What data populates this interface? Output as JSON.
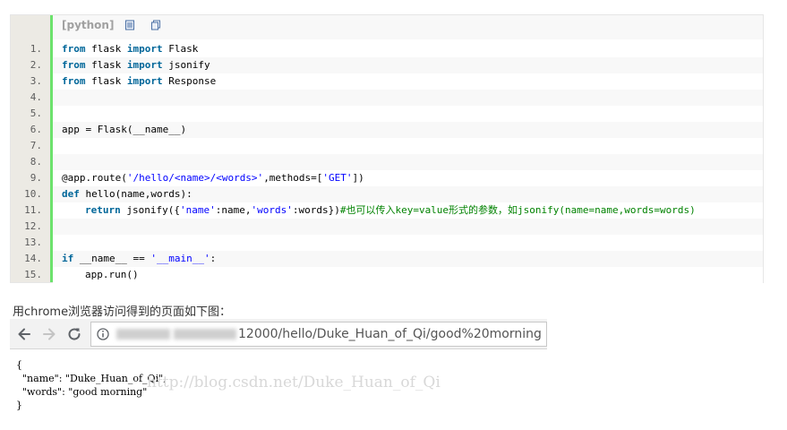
{
  "code_block": {
    "language_label": "[python]",
    "toolbar_icons": [
      "view-source-icon",
      "copy-icon"
    ],
    "lines": [
      {
        "num": "1.",
        "tokens": [
          {
            "t": "from",
            "c": "kw"
          },
          {
            "t": " flask ",
            "c": ""
          },
          {
            "t": "import",
            "c": "kw"
          },
          {
            "t": " Flask",
            "c": ""
          }
        ]
      },
      {
        "num": "2.",
        "tokens": [
          {
            "t": "from",
            "c": "kw"
          },
          {
            "t": " flask ",
            "c": ""
          },
          {
            "t": "import",
            "c": "kw"
          },
          {
            "t": " jsonify",
            "c": ""
          }
        ]
      },
      {
        "num": "3.",
        "tokens": [
          {
            "t": "from",
            "c": "kw"
          },
          {
            "t": " flask ",
            "c": ""
          },
          {
            "t": "import",
            "c": "kw"
          },
          {
            "t": " Response",
            "c": ""
          }
        ]
      },
      {
        "num": "4.",
        "tokens": []
      },
      {
        "num": "5.",
        "tokens": []
      },
      {
        "num": "6.",
        "tokens": [
          {
            "t": "app = Flask(__name__)",
            "c": ""
          }
        ]
      },
      {
        "num": "7.",
        "tokens": []
      },
      {
        "num": "8.",
        "tokens": []
      },
      {
        "num": "9.",
        "tokens": [
          {
            "t": "@app.route(",
            "c": ""
          },
          {
            "t": "'/hello/<name>/<words>'",
            "c": "str"
          },
          {
            "t": ",methods=[",
            "c": ""
          },
          {
            "t": "'GET'",
            "c": "str"
          },
          {
            "t": "])",
            "c": ""
          }
        ]
      },
      {
        "num": "10.",
        "tokens": [
          {
            "t": "def",
            "c": "kw"
          },
          {
            "t": " hello(name,words):",
            "c": ""
          }
        ]
      },
      {
        "num": "11.",
        "indent": true,
        "tokens": [
          {
            "t": "return",
            "c": "kw"
          },
          {
            "t": " jsonify({",
            "c": ""
          },
          {
            "t": "'name'",
            "c": "str"
          },
          {
            "t": ":name,",
            "c": ""
          },
          {
            "t": "'words'",
            "c": "str"
          },
          {
            "t": ":words})",
            "c": ""
          },
          {
            "t": "#也可以传入key=value形式的参数，如jsonify(name=name,words=words)",
            "c": "cmt"
          }
        ]
      },
      {
        "num": "12.",
        "tokens": []
      },
      {
        "num": "13.",
        "tokens": []
      },
      {
        "num": "14.",
        "tokens": [
          {
            "t": "if",
            "c": "kw"
          },
          {
            "t": " __name__ == ",
            "c": ""
          },
          {
            "t": "'__main__'",
            "c": "str"
          },
          {
            "t": ":",
            "c": ""
          }
        ]
      },
      {
        "num": "15.",
        "indent": true,
        "tokens": [
          {
            "t": "app.run()",
            "c": ""
          }
        ]
      }
    ]
  },
  "caption": "用chrome浏览器访问得到的页面如下图：",
  "browser": {
    "url_visible": "12000/hello/Duke_Huan_of_Qi/good%20morning",
    "icons": [
      "back-arrow-icon",
      "forward-arrow-icon",
      "reload-icon",
      "info-icon"
    ]
  },
  "json_output": {
    "lines": [
      "{",
      "  \"name\": \"Duke_Huan_of_Qi\",",
      "  \"words\": \"good morning\"",
      "}"
    ]
  },
  "watermark": "http://blog.csdn.net/Duke_Huan_of_Qi",
  "colors": {
    "keyword": "#006699",
    "string": "#0000ff",
    "comment": "#008200",
    "gutter": "#eceae4",
    "gutter_bar": "#6ce26c"
  }
}
